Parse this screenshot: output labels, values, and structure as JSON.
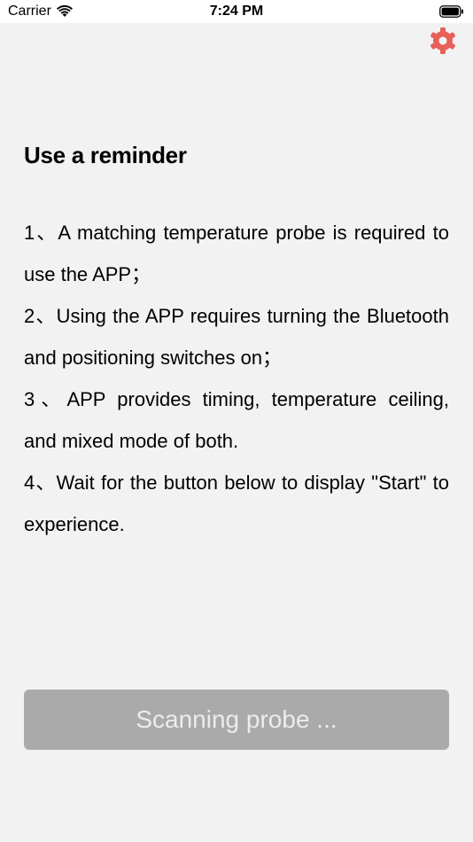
{
  "status_bar": {
    "carrier": "Carrier",
    "time": "7:24 PM"
  },
  "header": {
    "settings_icon": "gear-icon",
    "settings_color": "#e8605a"
  },
  "reminder": {
    "title": "Use a reminder",
    "items": [
      "1、A matching temperature probe is required to use the APP；",
      "2、Using the APP requires turning the Bluetooth and positioning switches on；",
      "3、APP provides timing, temperature ceiling, and mixed mode of both.",
      "4、Wait for the button below to display \"Start\" to experience."
    ]
  },
  "action": {
    "label": "Scanning probe ...",
    "background": "#aaaaaa"
  }
}
